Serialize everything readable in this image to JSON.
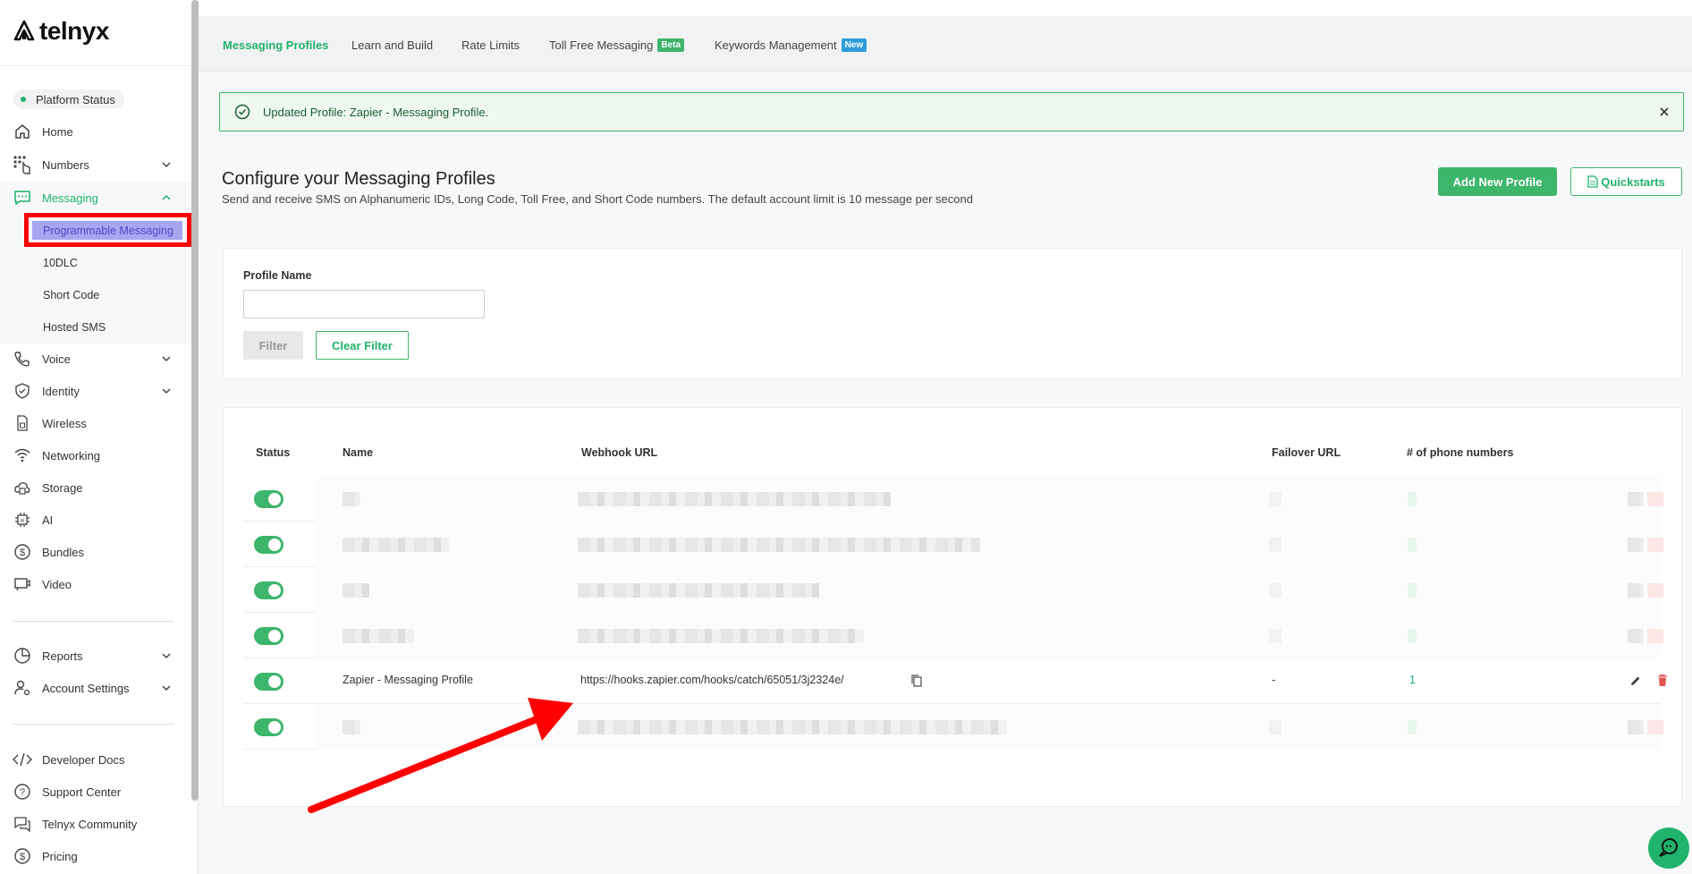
{
  "brand": {
    "name": "telnyx"
  },
  "sidebar": {
    "platform_status": "Platform Status",
    "items": [
      {
        "label": "Home",
        "icon": "home-icon"
      },
      {
        "label": "Numbers",
        "icon": "numbers-icon"
      },
      {
        "label": "Messaging",
        "icon": "messaging-icon"
      },
      {
        "label": "Voice",
        "icon": "voice-icon"
      },
      {
        "label": "Identity",
        "icon": "identity-icon"
      },
      {
        "label": "Wireless",
        "icon": "wireless-icon"
      },
      {
        "label": "Networking",
        "icon": "networking-icon"
      },
      {
        "label": "Storage",
        "icon": "storage-icon"
      },
      {
        "label": "AI",
        "icon": "ai-icon"
      },
      {
        "label": "Bundles",
        "icon": "bundles-icon"
      },
      {
        "label": "Video",
        "icon": "video-icon"
      },
      {
        "label": "Reports",
        "icon": "reports-icon"
      },
      {
        "label": "Account Settings",
        "icon": "account-settings-icon"
      },
      {
        "label": "Developer Docs",
        "icon": "developer-docs-icon"
      },
      {
        "label": "Support Center",
        "icon": "support-center-icon"
      },
      {
        "label": "Telnyx Community",
        "icon": "community-icon"
      },
      {
        "label": "Pricing",
        "icon": "pricing-icon"
      }
    ],
    "messaging_sub": [
      "Programmable Messaging",
      "10DLC",
      "Short Code",
      "Hosted SMS"
    ]
  },
  "tabs": [
    {
      "label": "Messaging Profiles"
    },
    {
      "label": "Learn and Build"
    },
    {
      "label": "Rate Limits"
    },
    {
      "label": "Toll Free Messaging",
      "badge": "Beta"
    },
    {
      "label": "Keywords Management",
      "badge": "New"
    }
  ],
  "alert": {
    "message": "Updated Profile: Zapier - Messaging Profile."
  },
  "page": {
    "title": "Configure your Messaging Profiles",
    "subtitle": "Send and receive SMS on Alphanumeric IDs, Long Code, Toll Free, and Short Code numbers. The default account limit is 10 message per second",
    "add_button": "Add New Profile",
    "quickstarts_button": "Quickstarts"
  },
  "filter": {
    "label": "Profile Name",
    "value": "",
    "filter_button": "Filter",
    "clear_button": "Clear Filter"
  },
  "table": {
    "headers": [
      "Status",
      "Name",
      "Webhook URL",
      "Failover URL",
      "# of phone numbers"
    ],
    "visible_row": {
      "name": "Zapier - Messaging Profile",
      "webhook": "https://hooks.zapier.com/hooks/catch/65051/3j2324e/",
      "failover": "-",
      "phone_count": "1"
    }
  },
  "colors": {
    "accent": "#1fb36b",
    "beta_badge": "#3db56a",
    "new_badge": "#2d9cdb",
    "highlight": "#ff0000"
  }
}
